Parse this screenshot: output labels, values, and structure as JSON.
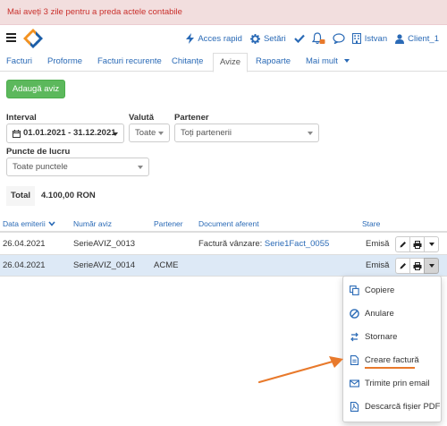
{
  "alert": {
    "text": "Mai aveți 3 zile pentru a preda actele contabile"
  },
  "header": {
    "quick_access_label": "Acces rapid",
    "settings_label": "Setări",
    "user1_label": "Istvan",
    "user2_label": "Client_1"
  },
  "tabs": [
    {
      "label": "Facturi"
    },
    {
      "label": "Proforme"
    },
    {
      "label": "Facturi recurente"
    },
    {
      "label": "Chitanțe"
    },
    {
      "label": "Avize"
    },
    {
      "label": "Rapoarte"
    },
    {
      "label": "Mai mult"
    }
  ],
  "active_tab": "Avize",
  "add_button_label": "Adaugă aviz",
  "filters": {
    "interval_label": "Interval",
    "interval_value": "01.01.2021 - 31.12.2021",
    "currency_label": "Valută",
    "currency_value": "Toate",
    "partner_label": "Partener",
    "partner_value": "Toți partenerii",
    "workpoints_label": "Puncte de lucru",
    "workpoints_value": "Toate punctele"
  },
  "total": {
    "label": "Total",
    "value": "4.100,00 RON"
  },
  "table": {
    "columns": [
      "Data emiterii",
      "Număr aviz",
      "Partener",
      "Document aferent",
      "Stare"
    ],
    "rows": [
      {
        "date": "26.04.2021",
        "number": "SerieAVIZ_0013",
        "partner": "",
        "doc_prefix": "Factură vânzare: ",
        "doc_link": "Serie1Fact_0055",
        "status": "Emisă"
      },
      {
        "date": "26.04.2021",
        "number": "SerieAVIZ_0014",
        "partner": "ACME",
        "doc_prefix": "",
        "doc_link": "",
        "status": "Emisă"
      }
    ]
  },
  "dropdown_menu": [
    {
      "label": "Copiere",
      "icon": "copy-icon"
    },
    {
      "label": "Anulare",
      "icon": "cancel-icon"
    },
    {
      "label": "Stornare",
      "icon": "reverse-icon"
    },
    {
      "label": "Creare factură",
      "icon": "document-icon"
    },
    {
      "label": "Trimite prin email",
      "icon": "email-icon"
    },
    {
      "label": "Descarcă fișier PDF",
      "icon": "pdf-icon"
    }
  ],
  "colors": {
    "link": "#2a6ab6",
    "success": "#5cb85c",
    "alert_bg": "#f2dede",
    "alert_text": "#c9302c",
    "selected_row": "#dde9f6",
    "annotation_arrow": "#e8792b"
  }
}
